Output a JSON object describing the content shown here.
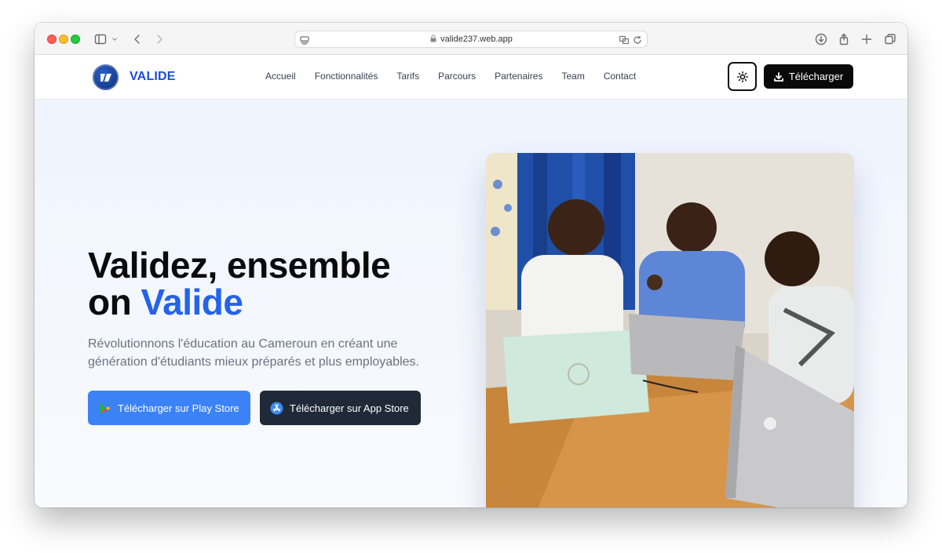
{
  "browser": {
    "url": "valide237.web.app"
  },
  "header": {
    "brand": "VALIDE",
    "nav": [
      "Accueil",
      "Fonctionnalités",
      "Tarifs",
      "Parcours",
      "Partenaires",
      "Team",
      "Contact"
    ],
    "theme_toggle_icon": "sun-icon",
    "download_label": "Télécharger"
  },
  "hero": {
    "title_line1": "Validez, ensemble",
    "title_line2_prefix": "on ",
    "title_line2_accent": "Valide",
    "subtitle": "Révolutionnons l'éducation au Cameroun en créant une génération d'étudiants mieux préparés et plus employables.",
    "play_store_label": "Télécharger sur Play Store",
    "app_store_label": "Télécharger sur App Store",
    "image_icon": "team-photo"
  },
  "colors": {
    "brand": "#1d4ed8",
    "accent": "#2563eb",
    "play_button": "#3b82f6",
    "app_button": "#1f2937",
    "download_button": "#0a0a0a"
  }
}
